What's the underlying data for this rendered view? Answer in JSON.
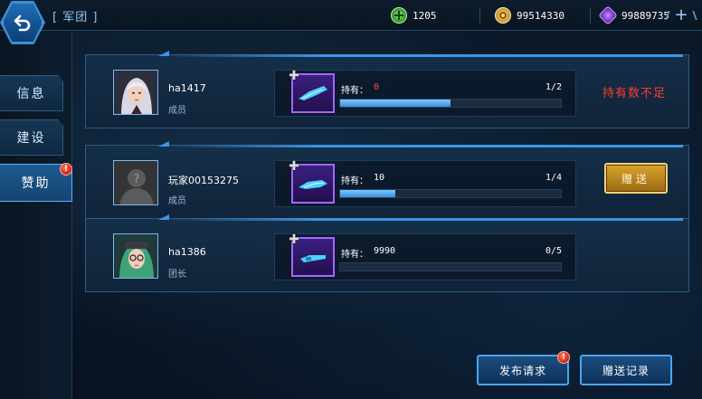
{
  "header": {
    "title": "[ 军团 ]",
    "currencies": [
      {
        "icon": "green-plus-coin-icon",
        "value": "1205",
        "color": "#4fc23a"
      },
      {
        "icon": "gold-coin-icon",
        "value": "99514330",
        "color": "#e2a72b"
      },
      {
        "icon": "purple-gem-icon",
        "value": "99889735",
        "color": "#8c3ce0"
      }
    ],
    "add_label": "+"
  },
  "sidebar": {
    "tabs": [
      {
        "label": "信息",
        "active": false
      },
      {
        "label": "建设",
        "active": false
      },
      {
        "label": "赞助",
        "active": true,
        "alert": "!"
      }
    ]
  },
  "members": [
    {
      "name": "ha1417",
      "role": "成员",
      "avatar": "white-haired-heroine-avatar",
      "hold_label": "持有：",
      "hold_value": "0",
      "fraction": "1/2",
      "progress": 0.5,
      "status_text": "持有数不足"
    },
    {
      "name": "玩家00153275",
      "role": "成员",
      "avatar": "default-silhouette-avatar",
      "hold_label": "持有：",
      "hold_value": "10",
      "fraction": "1/4",
      "progress": 0.25,
      "action_label": "赠送"
    },
    {
      "name": "ha1386",
      "role": "团长",
      "avatar": "green-haired-heroine-avatar",
      "hold_label": "持有：",
      "hold_value": "9990",
      "fraction": "0/5",
      "progress": 0
    }
  ],
  "footer": {
    "request_label": "发布请求",
    "request_alert": "!",
    "record_label": "赠送记录"
  },
  "colors": {
    "accent": "#3c96e6",
    "warning": "#ff3b30",
    "gold_button": "#c48f22",
    "item_frame": "#a565ff"
  }
}
